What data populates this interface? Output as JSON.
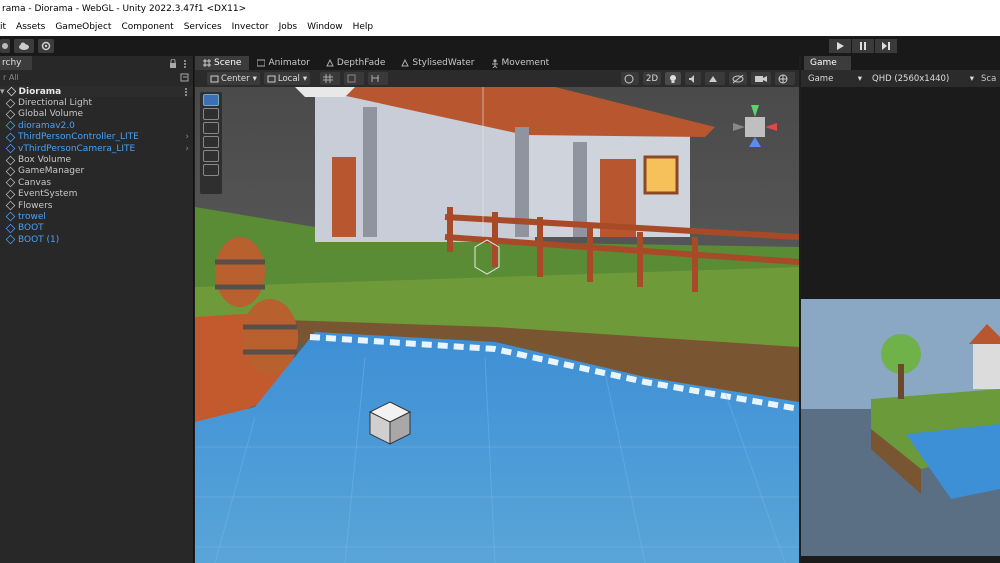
{
  "window": {
    "title": "rama - Diorama - WebGL - Unity 2022.3.47f1 <DX11>"
  },
  "menu": [
    "it",
    "Assets",
    "GameObject",
    "Component",
    "Services",
    "Invector",
    "Jobs",
    "Window",
    "Help"
  ],
  "hierarchy": {
    "tab_label": "rchy",
    "search_placeholder": "r All",
    "root": "Diorama",
    "items": [
      {
        "label": "Directional Light",
        "prefab": false
      },
      {
        "label": "Global Volume",
        "prefab": false
      },
      {
        "label": "dioramav2.0",
        "prefab": true
      },
      {
        "label": "ThirdPersonController_LITE",
        "prefab": true
      },
      {
        "label": "vThirdPersonCamera_LITE",
        "prefab": true
      },
      {
        "label": "Box Volume",
        "prefab": false
      },
      {
        "label": "GameManager",
        "prefab": false
      },
      {
        "label": "Canvas",
        "prefab": false
      },
      {
        "label": "EventSystem",
        "prefab": false
      },
      {
        "label": "Flowers",
        "prefab": false
      },
      {
        "label": "trowel",
        "prefab": true
      },
      {
        "label": "BOOT",
        "prefab": true
      },
      {
        "label": "BOOT (1)",
        "prefab": true
      }
    ]
  },
  "scene_tabs": [
    {
      "label": "Scene",
      "icon": "grid-icon",
      "active": true
    },
    {
      "label": "Animator",
      "icon": "animator-icon",
      "active": false
    },
    {
      "label": "DepthFade",
      "icon": "shader-icon",
      "active": false
    },
    {
      "label": "StylisedWater",
      "icon": "shader-icon",
      "active": false
    },
    {
      "label": "Movement",
      "icon": "person-icon",
      "active": false
    }
  ],
  "scene_toolbar": {
    "pivot": "Center",
    "space": "Local",
    "mode_2d": "2D"
  },
  "game": {
    "tab_label": "Game",
    "display": "Game",
    "resolution": "QHD (2560x1440)",
    "scale_label": "Sca"
  },
  "colors": {
    "accent": "#4ba1f5",
    "panel": "#282828",
    "toolbar": "#191919",
    "water": "#3b8fd4"
  }
}
